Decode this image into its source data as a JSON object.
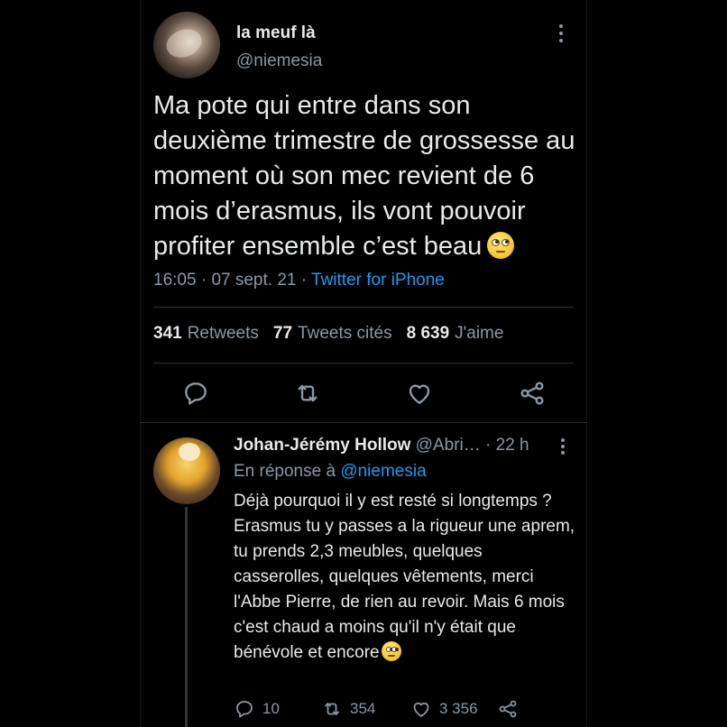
{
  "tweet": {
    "display_name": "la meuf là",
    "handle": "@niemesia",
    "text": "Ma pote qui entre dans son deuxième trimestre de grossesse au moment où son mec revient de 6 mois d’erasmus, ils vont pouvoir profiter ensemble c’est beau",
    "emoji": "face-with-rolling-eyes",
    "time": "16:05",
    "date": "07 sept. 21",
    "separator": "·",
    "source": "Twitter for iPhone",
    "stats": {
      "retweets_count": "341",
      "retweets_label": "Retweets",
      "quotes_count": "77",
      "quotes_label": "Tweets cités",
      "likes_count": "8 639",
      "likes_label": "J'aime"
    },
    "actions": [
      "reply-icon",
      "retweet-icon",
      "like-icon",
      "share-icon"
    ]
  },
  "reply": {
    "display_name": "Johan-Jérémy Hollow",
    "handle": "@Abri…",
    "time_ago": "· 22 h",
    "reply_prefix": "En réponse à",
    "reply_to": "@niemesia",
    "text": "Déjà pourquoi il y est resté si longtemps ? Erasmus tu y passes a la rigueur une aprem, tu prends 2,3 meubles, quelques casserolles, quelques vêtements, merci l'Abbe Pierre, de rien au revoir. Mais 6 mois c'est chaud a moins qu'il n'y était que bénévole et encore",
    "emoji": "thinking-face",
    "reply_count": "10",
    "retweet_count": "354",
    "like_count": "3 356"
  },
  "colors": {
    "background": "#000000",
    "text": "#e7e9ea",
    "secondary": "#8b98a5",
    "accent": "#1d9bf0",
    "divider": "#2f3336"
  }
}
